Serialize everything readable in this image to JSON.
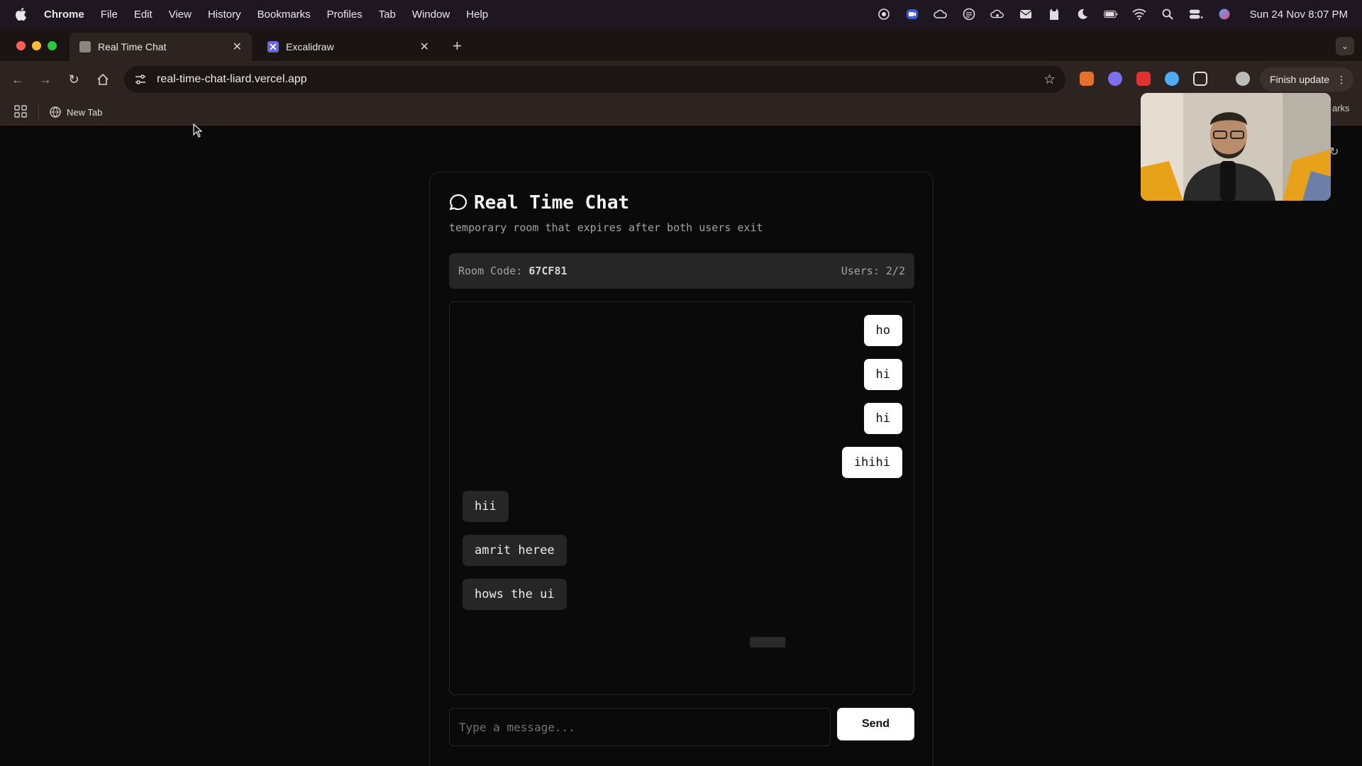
{
  "menubar": {
    "app_name": "Chrome",
    "items": [
      "File",
      "Edit",
      "View",
      "History",
      "Bookmarks",
      "Profiles",
      "Tab",
      "Window",
      "Help"
    ],
    "clock": "Sun 24 Nov  8:07 PM",
    "status_icons": [
      "screen-record-icon",
      "zoom-icon",
      "cloud-icon",
      "grammarly-icon",
      "cloud-sync-icon",
      "mail-icon",
      "cat-icon",
      "moon-icon",
      "battery-icon",
      "wifi-icon",
      "search-icon",
      "control-center-icon",
      "siri-icon"
    ]
  },
  "browser": {
    "tabs": [
      {
        "title": "Real Time Chat",
        "active": true,
        "icon": "page-icon"
      },
      {
        "title": "Excalidraw",
        "active": false,
        "icon": "excalidraw-icon"
      }
    ],
    "url": "real-time-chat-liard.vercel.app",
    "finish_update_label": "Finish update",
    "bookmark_items": [
      "New Tab"
    ],
    "bookmarks_right_label": "arks"
  },
  "chat": {
    "title": "Real Time Chat",
    "subtitle": "temporary room that expires after both users exit",
    "room_code_label": "Room Code:",
    "room_code": "67CF81",
    "users_label": "Users: 2/2",
    "messages": [
      {
        "text": "ho",
        "sender": "me"
      },
      {
        "text": "hi",
        "sender": "me"
      },
      {
        "text": "hi",
        "sender": "me"
      },
      {
        "text": "ihihi",
        "sender": "me"
      },
      {
        "text": "hii",
        "sender": "other"
      },
      {
        "text": "amrit heree",
        "sender": "other"
      },
      {
        "text": "hows the ui",
        "sender": "other"
      }
    ],
    "input_placeholder": "Type a message...",
    "send_label": "Send"
  },
  "colors": {
    "page_bg": "#0a0a0a",
    "mine_bubble": "#ffffff",
    "theirs_bubble": "#262626",
    "tab_active": "#2d2421",
    "menubar_bg": "#1e1620"
  }
}
